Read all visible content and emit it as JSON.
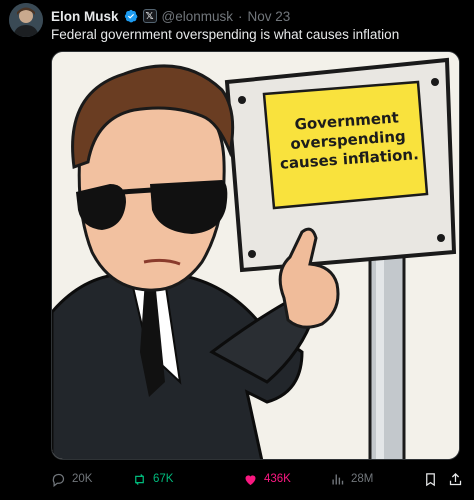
{
  "author": {
    "name": "Elon Musk",
    "handle": "@elonmusk",
    "separator": "·",
    "date": "Nov 23",
    "affiliate_badge": "𝕏"
  },
  "tweet": {
    "text": "Federal government overspending is what causes inflation"
  },
  "media": {
    "sign_lines": [
      "Government",
      "overspending",
      "causes inflation."
    ]
  },
  "actions": {
    "replies": "20K",
    "reposts": "67K",
    "likes": "436K",
    "views": "28M"
  },
  "colors": {
    "background": "#000000",
    "text": "#e7e9ea",
    "muted": "#71767b",
    "verified": "#1d9bf0",
    "repost_active": "#00ba7c",
    "like_active": "#f91880",
    "sign_yellow": "#f9e23d"
  },
  "icons": [
    "reply-icon",
    "repost-icon",
    "heart-icon",
    "views-icon",
    "bookmark-icon",
    "share-icon",
    "verified-badge-icon"
  ]
}
